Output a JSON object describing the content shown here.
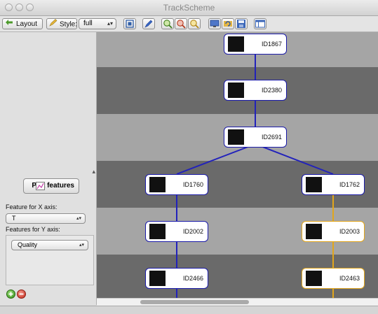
{
  "window": {
    "title": "TrackScheme"
  },
  "toolbar": {
    "layout_label": "Layout",
    "style_label": "Style:",
    "style_value": "full"
  },
  "panel": {
    "plot_button": "Plot features",
    "x_axis_label": "Feature for X axis:",
    "x_axis_value": "T",
    "y_axis_label": "Features for Y axis:",
    "y_axis_value": "Quality"
  },
  "tracks": {
    "row_colors": [
      "#a5a5a5",
      "#6a6a6a"
    ],
    "link_color_main": "#2222bb",
    "link_color_selected": "#e2a61c",
    "nodes": [
      {
        "id": "ID1867",
        "selected": false
      },
      {
        "id": "ID2380",
        "selected": false
      },
      {
        "id": "ID2691",
        "selected": false
      },
      {
        "id": "ID1760",
        "selected": false
      },
      {
        "id": "ID1762",
        "selected": false
      },
      {
        "id": "ID2002",
        "selected": false
      },
      {
        "id": "ID2003",
        "selected": true
      },
      {
        "id": "ID2466",
        "selected": false
      },
      {
        "id": "ID2463",
        "selected": true
      }
    ]
  }
}
